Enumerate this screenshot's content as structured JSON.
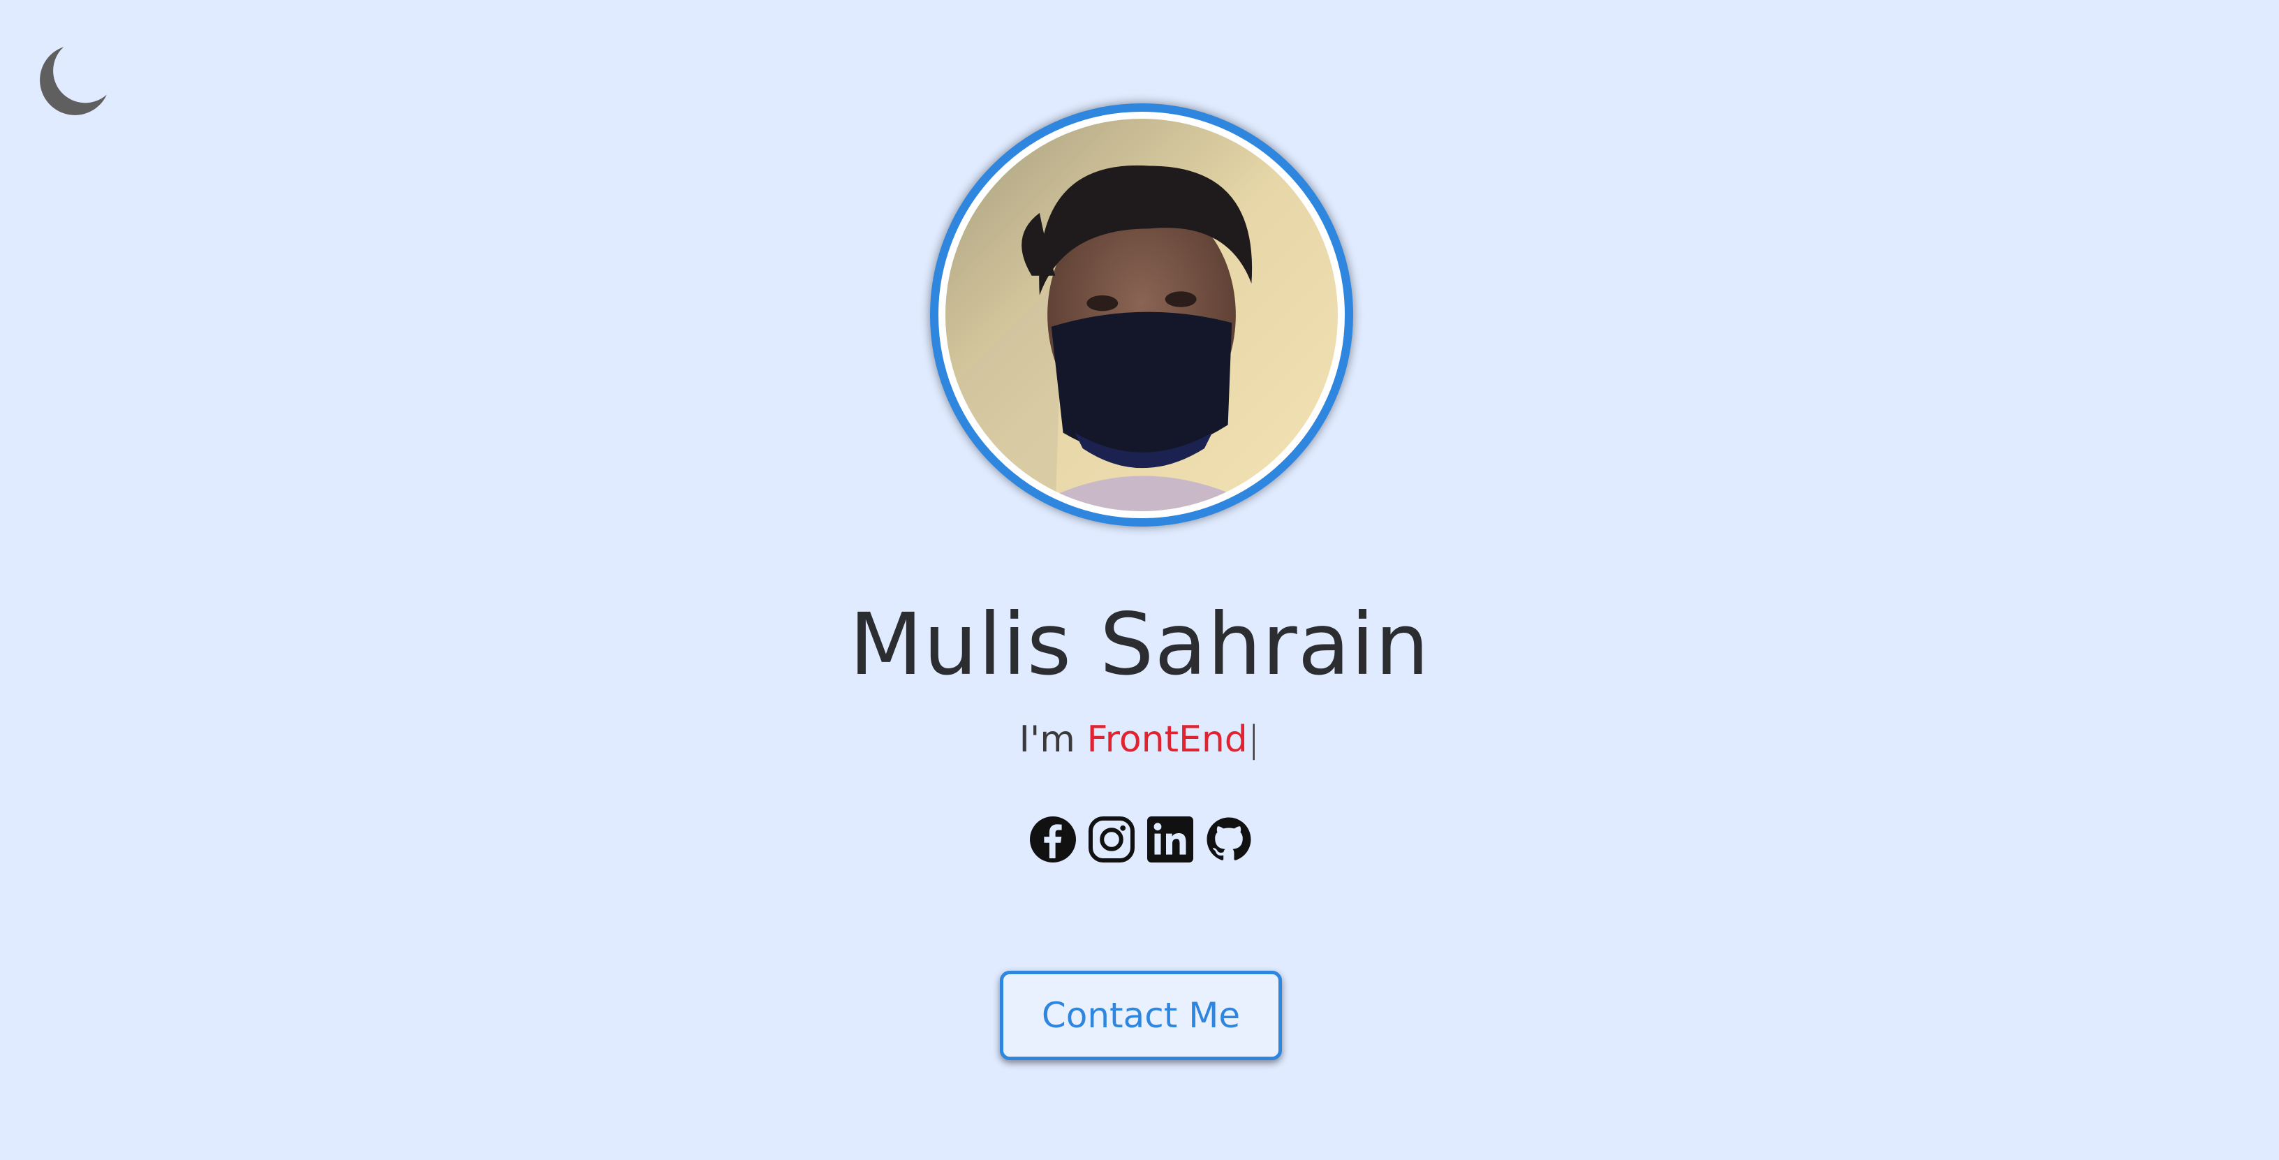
{
  "header": {
    "theme_toggle_icon": "moon-icon"
  },
  "profile": {
    "avatar_icon": "profile-photo",
    "name": "Mulis Sahrain",
    "tagline_prefix": "I'm ",
    "tagline_role": "FrontEnd",
    "tagline_cursor": "|"
  },
  "socials": [
    {
      "icon": "facebook-icon"
    },
    {
      "icon": "instagram-icon"
    },
    {
      "icon": "linkedin-icon"
    },
    {
      "icon": "github-icon"
    }
  ],
  "actions": {
    "contact_label": "Contact Me"
  },
  "colors": {
    "background": "#e0ebff",
    "accent": "#2f86df",
    "highlight": "#e0232f",
    "text": "#2b2d30"
  }
}
